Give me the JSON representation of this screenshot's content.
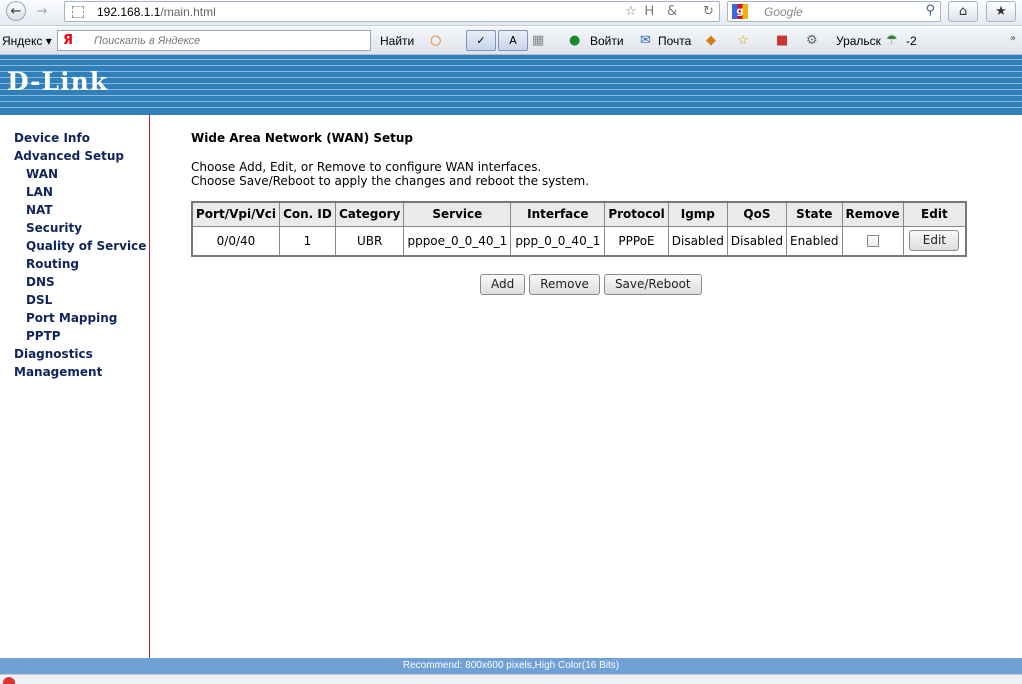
{
  "browser": {
    "url_host": "192.168.1.1",
    "url_path": "/main.html",
    "search_placeholder": "Google",
    "url_right_icons": [
      "☆",
      "Ꮋ",
      "&",
      "↻"
    ]
  },
  "yandex_bar": {
    "brand": "Яндекс",
    "search_placeholder": "Поискать в Яндексе",
    "find_label": "Найти",
    "login_label": "Войти",
    "mail_label": "Почта",
    "city_label": "Уральск",
    "temperature": "-2"
  },
  "router": {
    "logo": "D-Link",
    "menu": [
      {
        "label": "Device Info",
        "sub": false
      },
      {
        "label": "Advanced Setup",
        "sub": false
      },
      {
        "label": "WAN",
        "sub": true
      },
      {
        "label": "LAN",
        "sub": true
      },
      {
        "label": "NAT",
        "sub": true
      },
      {
        "label": "Security",
        "sub": true
      },
      {
        "label": "Quality of Service",
        "sub": true
      },
      {
        "label": "Routing",
        "sub": true
      },
      {
        "label": "DNS",
        "sub": true
      },
      {
        "label": "DSL",
        "sub": true
      },
      {
        "label": "Port Mapping",
        "sub": true
      },
      {
        "label": "PPTP",
        "sub": true
      },
      {
        "label": "Diagnostics",
        "sub": false
      },
      {
        "label": "Management",
        "sub": false
      }
    ],
    "page_title": "Wide Area Network (WAN) Setup",
    "desc1": "Choose Add, Edit, or Remove to configure WAN interfaces.",
    "desc2": "Choose Save/Reboot to apply the changes and reboot the system.",
    "table": {
      "headers": [
        "Port/Vpi/Vci",
        "Con. ID",
        "Category",
        "Service",
        "Interface",
        "Protocol",
        "Igmp",
        "QoS",
        "State",
        "Remove",
        "Edit"
      ],
      "rows": [
        {
          "port": "0/0/40",
          "con_id": "1",
          "category": "UBR",
          "service": "pppoe_0_0_40_1",
          "interface": "ppp_0_0_40_1",
          "protocol": "PPPoE",
          "igmp": "Disabled",
          "qos": "Disabled",
          "state": "Enabled",
          "remove_checked": false,
          "edit_label": "Edit"
        }
      ]
    },
    "buttons": {
      "add": "Add",
      "remove": "Remove",
      "save_reboot": "Save/Reboot"
    },
    "footer": "Recommend: 800x600 pixels,High Color(16 Bits)"
  }
}
